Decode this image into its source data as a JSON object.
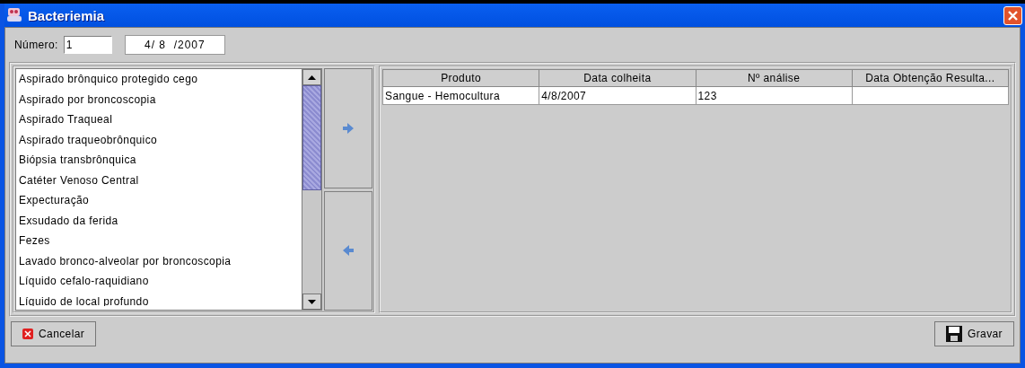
{
  "window": {
    "title": "Bacteriemia"
  },
  "numero": {
    "label": "Número:",
    "value": "1"
  },
  "date": {
    "value": "4/ 8  /2007"
  },
  "products": [
    {
      "label": "Aspirado brônquico protegido cego"
    },
    {
      "label": "Aspirado por broncoscopia"
    },
    {
      "label": "Aspirado Traqueal"
    },
    {
      "label": "Aspirado traqueobrônquico"
    },
    {
      "label": "Biópsia transbrônquica"
    },
    {
      "label": "Catéter Venoso Central"
    },
    {
      "label": "Expecturação"
    },
    {
      "label": "Exsudado da ferida"
    },
    {
      "label": "Fezes"
    },
    {
      "label": "Lavado bronco-alveolar por broncoscopia"
    },
    {
      "label": "Líquido cefalo-raquidiano"
    },
    {
      "label": "Líquido de local profundo"
    }
  ],
  "table": {
    "columns": [
      "Produto",
      "Data colheita",
      "Nº análise",
      "Data Obtenção Resulta..."
    ],
    "rows": [
      [
        "Sangue - Hemocultura",
        "4/8/2007",
        "123",
        ""
      ]
    ]
  },
  "buttons": [
    {
      "label": "Cancelar",
      "kind": "cancel"
    },
    {
      "label": "Gravar",
      "kind": "save"
    }
  ]
}
